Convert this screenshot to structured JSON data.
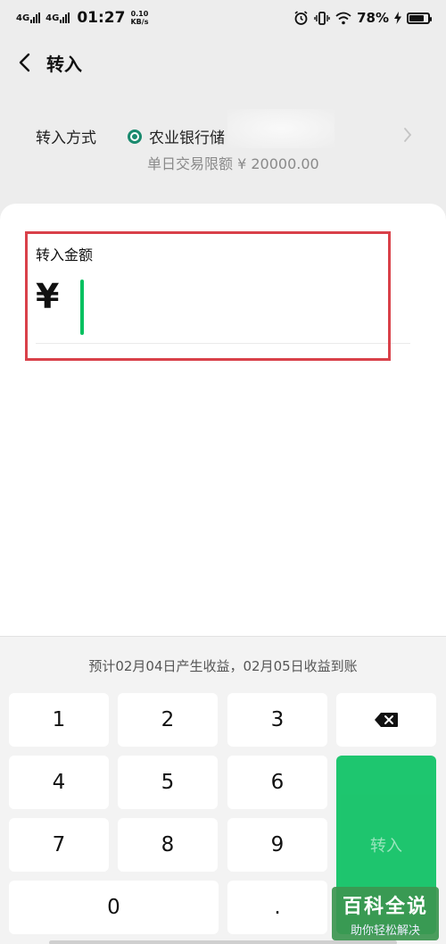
{
  "status_bar": {
    "signal_1": "4G",
    "signal_2": "4G",
    "time": "01:27",
    "speed_value": "0.10",
    "speed_unit": "KB/s",
    "battery_percent": "78%"
  },
  "header": {
    "title": "转入",
    "back_icon": "chevron-left-icon"
  },
  "method": {
    "label": "转入方式",
    "bank_name": "农业银行储",
    "bank_icon": "abc-bank-logo-icon",
    "limit": "单日交易限额 ¥ 20000.00"
  },
  "amount": {
    "title": "转入金额",
    "currency_symbol": "¥",
    "value": ""
  },
  "keypad": {
    "hint": "预计02月04日产生收益，02月05日收益到账",
    "keys": [
      "1",
      "2",
      "3",
      "4",
      "5",
      "6",
      "7",
      "8",
      "9",
      "0",
      "."
    ],
    "delete_icon": "backspace-icon",
    "submit_label": "转入"
  },
  "watermark": {
    "main": "百科全说",
    "sub": "助你轻松解决"
  },
  "colors": {
    "accent": "#07c160",
    "highlight": "#d9414a",
    "background": "#ededed"
  }
}
